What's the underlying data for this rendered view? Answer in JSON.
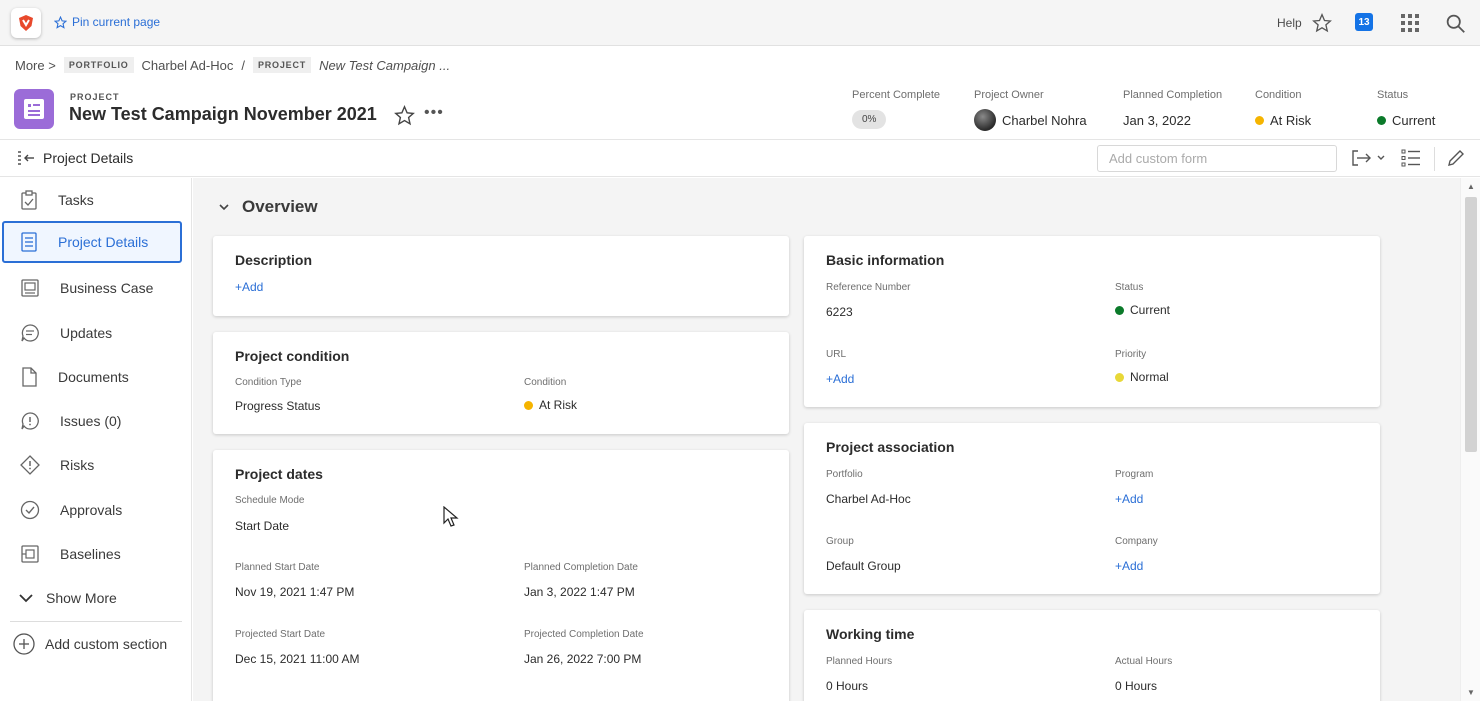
{
  "topbar": {
    "pin_label": "Pin current page",
    "help_label": "Help",
    "notifications_count": "13"
  },
  "breadcrumb": {
    "more": "More",
    "portfolio_tag": "PORTFOLIO",
    "portfolio_name": "Charbel Ad-Hoc",
    "separator": "/",
    "project_tag": "PROJECT",
    "project_name": "New Test Campaign ..."
  },
  "project": {
    "kicker": "PROJECT",
    "title": "New Test Campaign November 2021",
    "percent_complete_label": "Percent Complete",
    "percent_complete": "0%",
    "owner_label": "Project Owner",
    "owner": "Charbel Nohra",
    "planned_completion_label": "Planned Completion",
    "planned_completion": "Jan 3, 2022",
    "condition_label": "Condition",
    "condition": "At Risk",
    "status_label": "Status",
    "status": "Current"
  },
  "toolbar": {
    "collapse_label": "Project Details",
    "custom_form_placeholder": "Add custom form"
  },
  "sidebar": {
    "items": [
      {
        "label": "Tasks"
      },
      {
        "label": "Project Details"
      },
      {
        "label": "Business Case"
      },
      {
        "label": "Updates"
      },
      {
        "label": "Documents"
      },
      {
        "label": "Issues (0)"
      },
      {
        "label": "Risks"
      },
      {
        "label": "Approvals"
      },
      {
        "label": "Baselines"
      }
    ],
    "show_more": "Show More",
    "add_section": "Add custom section"
  },
  "overview": {
    "title": "Overview",
    "description": {
      "title": "Description",
      "add": "+Add"
    },
    "condition_card": {
      "title": "Project condition",
      "type_label": "Condition Type",
      "type_value": "Progress Status",
      "condition_label": "Condition",
      "condition_value": "At Risk"
    },
    "dates": {
      "title": "Project dates",
      "schedule_mode_label": "Schedule Mode",
      "schedule_mode": "Start Date",
      "planned_start_label": "Planned Start Date",
      "planned_start": "Nov 19, 2021 1:47 PM",
      "planned_completion_label": "Planned Completion Date",
      "planned_completion": "Jan 3, 2022 1:47 PM",
      "projected_start_label": "Projected Start Date",
      "projected_start": "Dec 15, 2021 11:00 AM",
      "projected_completion_label": "Projected Completion Date",
      "projected_completion": "Jan 26, 2022 7:00 PM"
    },
    "basic": {
      "title": "Basic information",
      "ref_label": "Reference Number",
      "ref_value": "6223",
      "status_label": "Status",
      "status_value": "Current",
      "url_label": "URL",
      "url_add": "+Add",
      "priority_label": "Priority",
      "priority_value": "Normal"
    },
    "association": {
      "title": "Project association",
      "portfolio_label": "Portfolio",
      "portfolio_value": "Charbel Ad-Hoc",
      "program_label": "Program",
      "program_add": "+Add",
      "group_label": "Group",
      "group_value": "Default Group",
      "company_label": "Company",
      "company_add": "+Add"
    },
    "working_time": {
      "title": "Working time",
      "planned_hours_label": "Planned Hours",
      "planned_hours": "0 Hours",
      "actual_hours_label": "Actual Hours",
      "actual_hours": "0 Hours"
    }
  },
  "colors": {
    "accent": "#2b6fd6",
    "project_icon": "#9b6cd8",
    "at_risk": "#f5b400",
    "current": "#0b7a2a",
    "normal_priority": "#e8d838",
    "logo_red": "#e8492c"
  }
}
